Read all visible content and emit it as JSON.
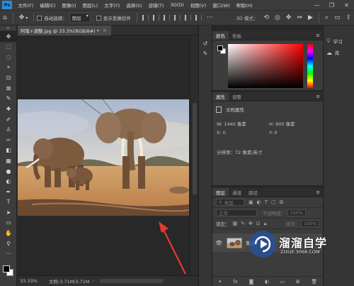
{
  "menubar": {
    "logo": "Ps",
    "items": [
      "文件(F)",
      "编辑(E)",
      "图像(I)",
      "图层(L)",
      "文字(Y)",
      "选择(S)",
      "滤镜(T)",
      "3D(D)",
      "视图(V)",
      "窗口(W)",
      "帮助(H)"
    ],
    "win_min": "—",
    "win_max": "❐",
    "win_close": "✕"
  },
  "options": {
    "auto_select_label": "自动选择：",
    "auto_select_value": "图层",
    "show_transform_label": "显示变换控件",
    "mode_3d_label": "3D 模式："
  },
  "document": {
    "tab_title": "阿笔+调整.jpg @ 33.3%(RGB/8#) *",
    "tab_close": "×",
    "zoom": "33.33%",
    "doc_info": "文档:3.71M/3.71M",
    "status_arrow": "›"
  },
  "color_panel": {
    "tabs": [
      "颜色",
      "色板"
    ],
    "fg_color": "#000000",
    "bg_color": "#ffffff"
  },
  "properties_panel": {
    "tabs": [
      "属性",
      "调整"
    ],
    "section_title": "文档属性",
    "w_label": "W:",
    "w_value": "1440 像素",
    "h_label": "H:",
    "h_value": "900 像素",
    "x_label": "X:",
    "x_value": "0",
    "y_label": "Y:",
    "y_value": "0",
    "resolution": "分辨率：72 像素/英寸"
  },
  "layers_panel": {
    "tabs": [
      "图层",
      "通道",
      "路径"
    ],
    "filter_kind": "类型",
    "blend_mode": "正常",
    "opacity_label": "不透明度：",
    "opacity_value": "100%",
    "lock_label": "锁定：",
    "fill_label": "填充：",
    "fill_value": "100%",
    "layer_name": "背景"
  },
  "right_dock": {
    "items": [
      {
        "icon": "lightbulb-icon",
        "label": "学习"
      },
      {
        "icon": "library-icon",
        "label": "库"
      }
    ]
  },
  "watermark": {
    "title": "溜溜自学",
    "url": "ZIXUE.3066.COM"
  }
}
